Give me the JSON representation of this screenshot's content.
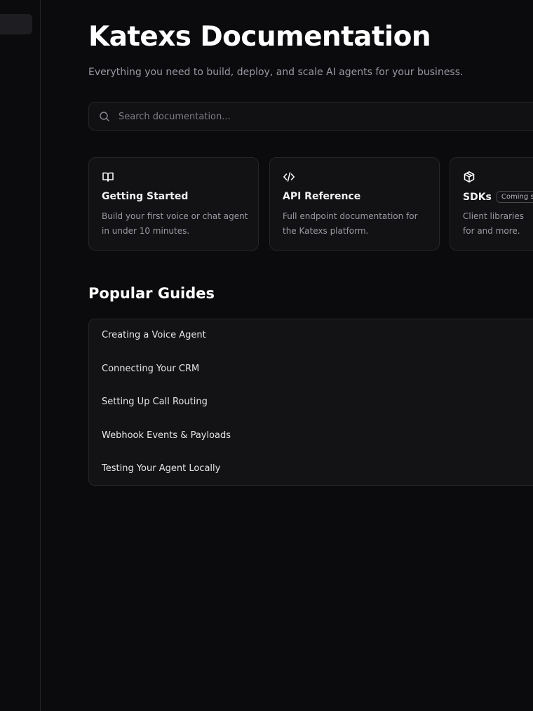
{
  "page": {
    "title": "Katexs Documentation",
    "subtitle": "Everything you need to build, deploy, and scale AI agents for your business."
  },
  "search": {
    "placeholder": "Search documentation...",
    "icon": "search-icon"
  },
  "cards": [
    {
      "icon": "book-icon",
      "title": "Getting Started",
      "description": "Build your first voice or chat agent in under 10 minutes."
    },
    {
      "icon": "code-icon",
      "title": "API Reference",
      "description": "Full endpoint documentation for the Katexs platform."
    },
    {
      "icon": "package-icon",
      "title": "SDKs",
      "badge": "Coming soo",
      "description": "Client libraries for and more."
    }
  ],
  "guides": {
    "title": "Popular Guides",
    "items": [
      "Creating a Voice Agent",
      "Connecting Your CRM",
      "Setting Up Call Routing",
      "Webhook Events & Payloads",
      "Testing Your Agent Locally"
    ]
  },
  "colors": {
    "background": "#0b0b0e",
    "card": "#121215",
    "border": "#26262a",
    "muted_text": "#9a9aa2"
  }
}
